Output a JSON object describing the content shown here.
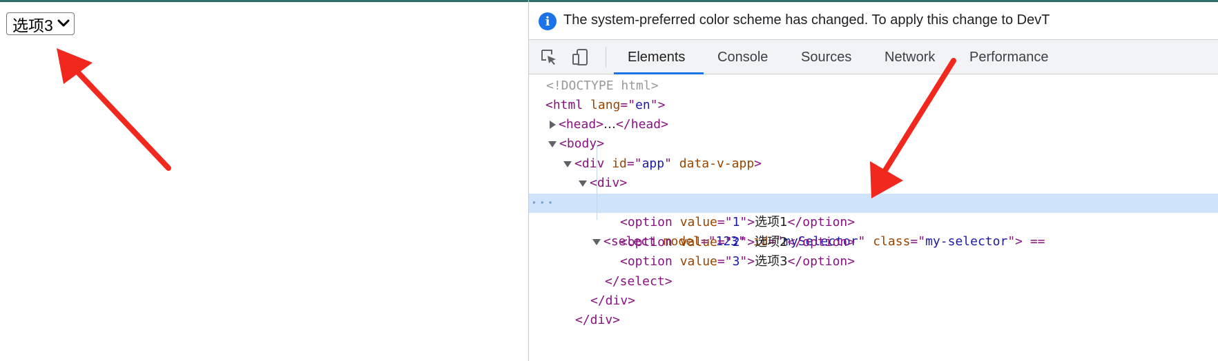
{
  "page": {
    "select_value": "选项3"
  },
  "devtools": {
    "infobar": {
      "icon": "info-icon",
      "text": "The system-preferred color scheme has changed. To apply this change to DevT"
    },
    "tabs": [
      "Elements",
      "Console",
      "Sources",
      "Network",
      "Performance"
    ],
    "active_tab": "Elements",
    "tree": {
      "doctype": "<!DOCTYPE html>",
      "html_tag": "html",
      "html_attr": "lang",
      "html_val": "en",
      "head": "head",
      "head_ellipsis": "…",
      "body": "body",
      "div_app_attr1": "id",
      "div_app_val1": "app",
      "div_app_attr2": "data-v-app",
      "select_attr1": "model",
      "select_val1": "123",
      "select_attr2": "id",
      "select_val2": "mySelector",
      "select_attr3": "class",
      "select_val3": "my-selector",
      "select_suffix": " ==",
      "options": [
        {
          "value": "1",
          "text": "选项1"
        },
        {
          "value": "2",
          "text": "选项2"
        },
        {
          "value": "3",
          "text": "选项3"
        }
      ],
      "dots": "···"
    }
  },
  "colors": {
    "accent": "#1a73e8",
    "annotation_arrow": "#f0281e",
    "tag": "#881280",
    "attr": "#994500",
    "value": "#1a1aa6",
    "selected_row": "#cfe3fb"
  }
}
